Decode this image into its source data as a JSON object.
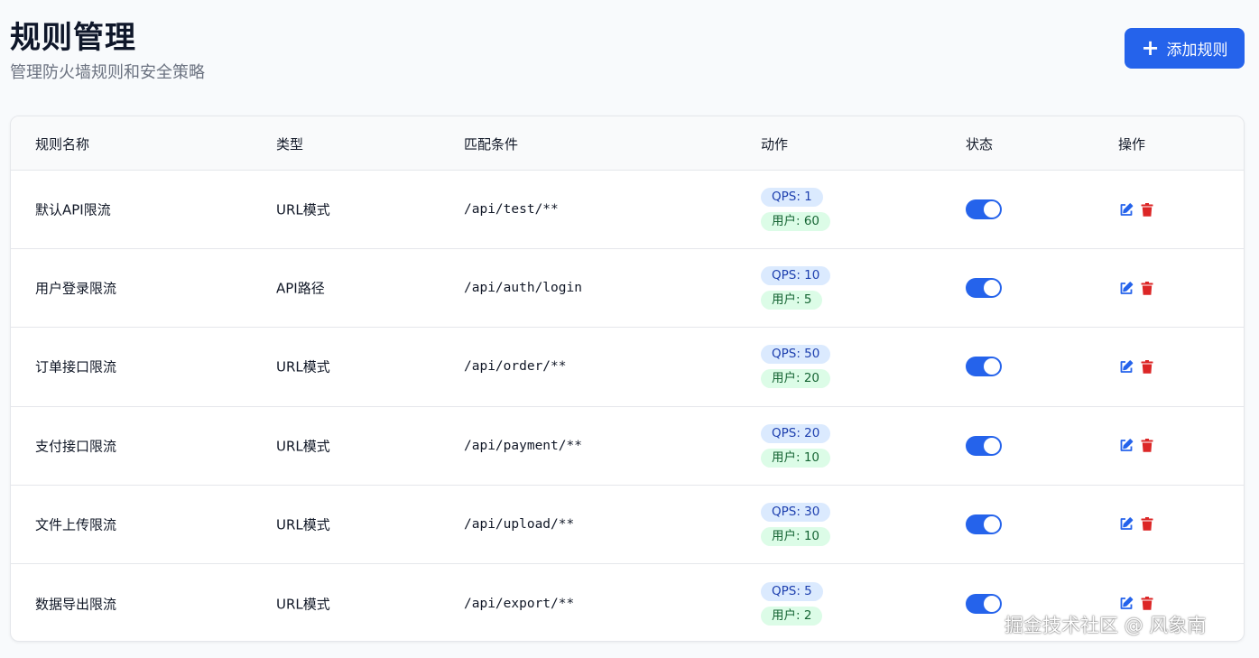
{
  "header": {
    "title": "规则管理",
    "subtitle": "管理防火墙规则和安全策略",
    "add_button_label": "添加规则",
    "add_button_icon": "plus-icon"
  },
  "table": {
    "columns": [
      "规则名称",
      "类型",
      "匹配条件",
      "动作",
      "状态",
      "操作"
    ],
    "rows": [
      {
        "name": "默认API限流",
        "type": "URL模式",
        "match": "/api/test/**",
        "qps": "QPS: 1",
        "user": "用户: 60",
        "enabled": true
      },
      {
        "name": "用户登录限流",
        "type": "API路径",
        "match": "/api/auth/login",
        "qps": "QPS: 10",
        "user": "用户: 5",
        "enabled": true
      },
      {
        "name": "订单接口限流",
        "type": "URL模式",
        "match": "/api/order/**",
        "qps": "QPS: 50",
        "user": "用户: 20",
        "enabled": true
      },
      {
        "name": "支付接口限流",
        "type": "URL模式",
        "match": "/api/payment/**",
        "qps": "QPS: 20",
        "user": "用户: 10",
        "enabled": true
      },
      {
        "name": "文件上传限流",
        "type": "URL模式",
        "match": "/api/upload/**",
        "qps": "QPS: 30",
        "user": "用户: 10",
        "enabled": true
      },
      {
        "name": "数据导出限流",
        "type": "URL模式",
        "match": "/api/export/**",
        "qps": "QPS: 5",
        "user": "用户: 2",
        "enabled": true
      }
    ]
  },
  "colors": {
    "primary": "#2563eb",
    "qps_badge_bg": "#dbeafe",
    "user_badge_bg": "#dcfce7",
    "delete_icon": "#dc2626"
  },
  "watermark": "掘金技术社区 @ 风象南"
}
